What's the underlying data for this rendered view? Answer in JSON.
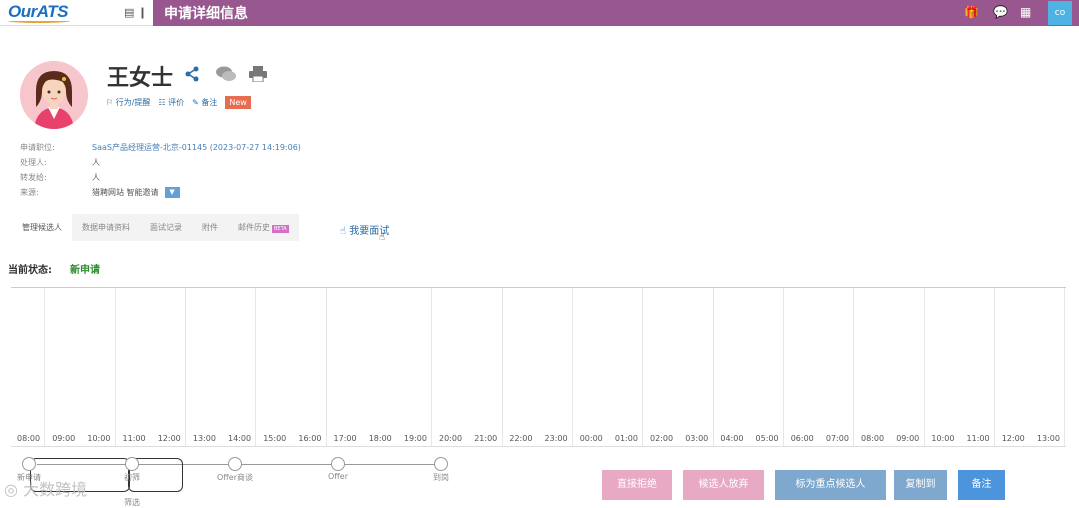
{
  "header": {
    "logo": "OurATS",
    "menu_toggle": "▤ ❙",
    "title": "申请详细信息",
    "user_initials": "co"
  },
  "candidate": {
    "name": "王女士",
    "tags": [
      "行为/提醒",
      "评价",
      "备注"
    ],
    "new_badge": "New"
  },
  "info": {
    "labels": [
      "申请职位:",
      "处理人:",
      "转发给:",
      "来源:"
    ],
    "position": "SaaS产品经理运营-北京-01145 (2023-07-27 14:19:06)",
    "handler": "人",
    "forwarded": "人",
    "source": "猎聘网站 智能邀请"
  },
  "tabs": [
    "管理候选人",
    "数据申请资料",
    "面试记录",
    "附件",
    "邮件历史"
  ],
  "tab_beta": "BETA",
  "interview_link": "我要面试",
  "status": {
    "label": "当前状态:",
    "value": "新申请"
  },
  "timeline": {
    "labels": [
      "08:00",
      "09:00",
      "10:00",
      "11:00",
      "12:00",
      "13:00",
      "14:00",
      "15:00",
      "16:00",
      "17:00",
      "18:00",
      "19:00",
      "20:00",
      "21:00",
      "22:00",
      "23:00",
      "00:00",
      "01:00",
      "02:00",
      "03:00",
      "04:00",
      "05:00",
      "06:00",
      "07:00",
      "08:00",
      "09:00",
      "10:00",
      "11:00",
      "12:00",
      "13:00"
    ]
  },
  "stages": [
    "新申请",
    "初筛",
    "Offer商谈",
    "Offer",
    "到岗"
  ],
  "stage_sub": "筛选",
  "actions": {
    "reject": "直接拒绝",
    "give_up": "候选人放弃",
    "mark_key": "标为重点候选人",
    "copy": "复制到",
    "note": "备注"
  },
  "colors": {
    "header_bg": "#98578e",
    "btn_pink": "#e8a9c4",
    "btn_blue_grey": "#7fa8cf",
    "btn_blue": "#4c94db"
  },
  "watermark": "大数跨境"
}
